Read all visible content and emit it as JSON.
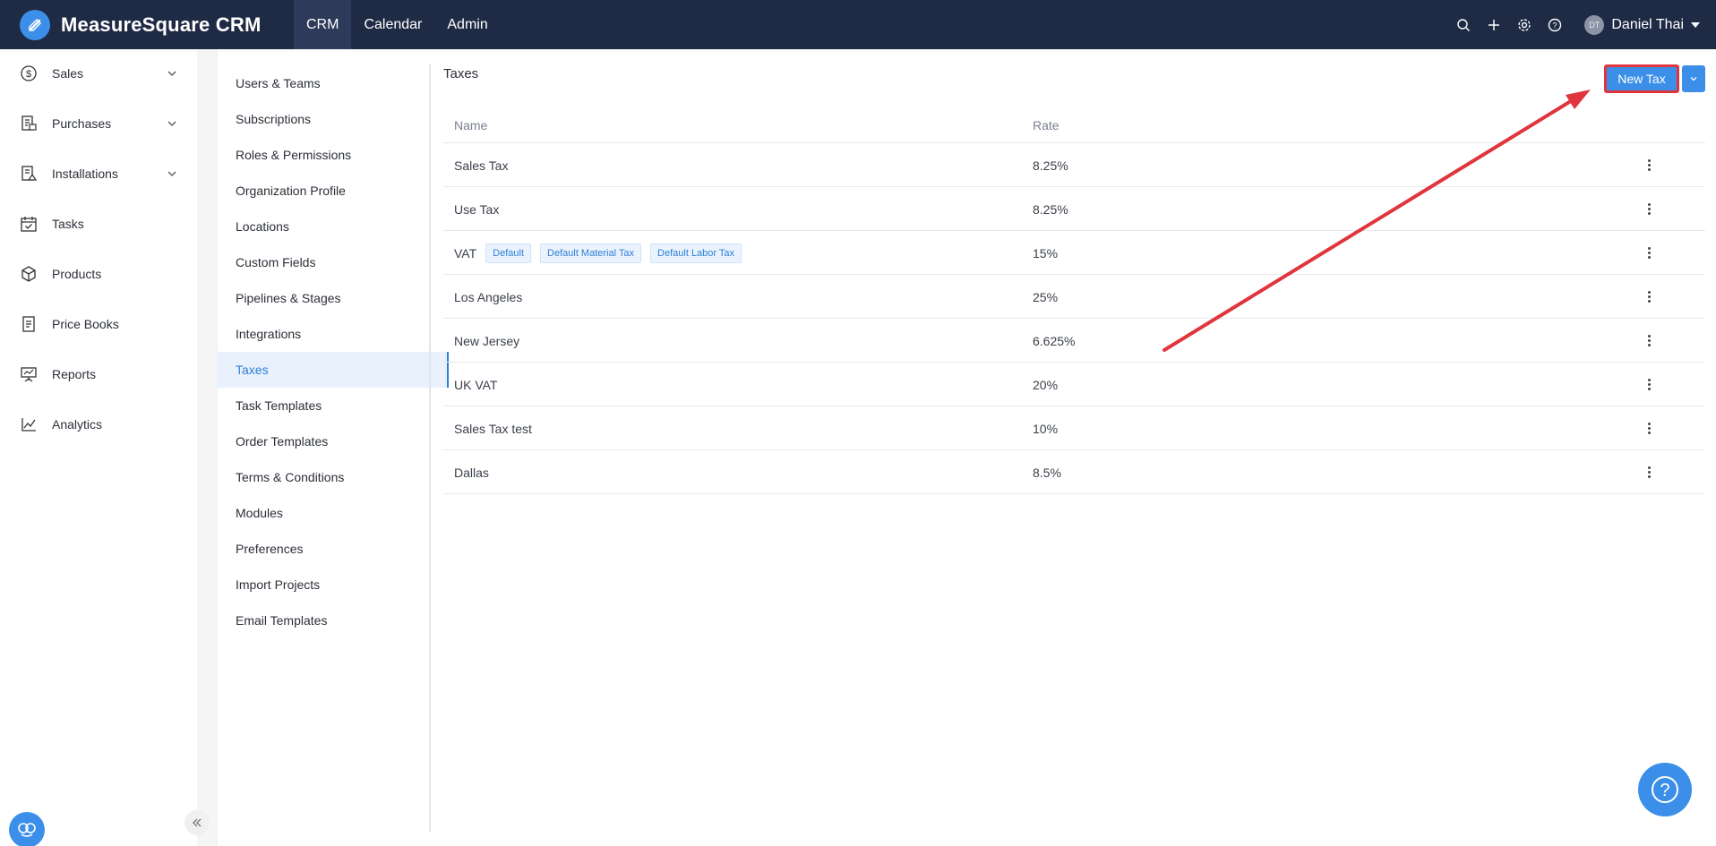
{
  "app": {
    "title": "MeasureSquare CRM"
  },
  "topnav": [
    {
      "label": "CRM",
      "active": true
    },
    {
      "label": "Calendar",
      "active": false
    },
    {
      "label": "Admin",
      "active": false
    }
  ],
  "user": {
    "initials": "DT",
    "name": "Daniel Thai"
  },
  "sidebar": {
    "items": [
      {
        "label": "Sales",
        "icon": "dollar-circle-icon",
        "expandable": true
      },
      {
        "label": "Purchases",
        "icon": "purchase-order-icon",
        "expandable": true
      },
      {
        "label": "Installations",
        "icon": "installation-icon",
        "expandable": true
      },
      {
        "label": "Tasks",
        "icon": "calendar-check-icon",
        "expandable": false
      },
      {
        "label": "Products",
        "icon": "box-icon",
        "expandable": false
      },
      {
        "label": "Price Books",
        "icon": "document-icon",
        "expandable": false
      },
      {
        "label": "Reports",
        "icon": "presentation-icon",
        "expandable": false
      },
      {
        "label": "Analytics",
        "icon": "line-chart-icon",
        "expandable": false
      }
    ]
  },
  "submenu": {
    "items": [
      {
        "label": "Users & Teams"
      },
      {
        "label": "Subscriptions"
      },
      {
        "label": "Roles & Permissions"
      },
      {
        "label": "Organization Profile"
      },
      {
        "label": "Locations"
      },
      {
        "label": "Custom Fields"
      },
      {
        "label": "Pipelines & Stages"
      },
      {
        "label": "Integrations"
      },
      {
        "label": "Taxes",
        "active": true
      },
      {
        "label": "Task Templates"
      },
      {
        "label": "Order Templates"
      },
      {
        "label": "Terms & Conditions"
      },
      {
        "label": "Modules"
      },
      {
        "label": "Preferences"
      },
      {
        "label": "Import Projects"
      },
      {
        "label": "Email Templates"
      }
    ]
  },
  "main": {
    "title": "Taxes",
    "new_button": "New Tax",
    "columns": {
      "name": "Name",
      "rate": "Rate"
    },
    "rows": [
      {
        "name": "Sales Tax",
        "rate": "8.25%",
        "tags": []
      },
      {
        "name": "Use Tax",
        "rate": "8.25%",
        "tags": []
      },
      {
        "name": "VAT",
        "rate": "15%",
        "tags": [
          "Default",
          "Default Material Tax",
          "Default Labor Tax"
        ]
      },
      {
        "name": "Los Angeles",
        "rate": "25%",
        "tags": []
      },
      {
        "name": "New Jersey",
        "rate": "6.625%",
        "tags": []
      },
      {
        "name": "UK VAT",
        "rate": "20%",
        "tags": []
      },
      {
        "name": "Sales Tax test",
        "rate": "10%",
        "tags": []
      },
      {
        "name": "Dallas",
        "rate": "8.5%",
        "tags": []
      }
    ]
  },
  "colors": {
    "topbar": "#1f2a44",
    "accent": "#3b8fe8",
    "highlight": "#e0353d"
  }
}
